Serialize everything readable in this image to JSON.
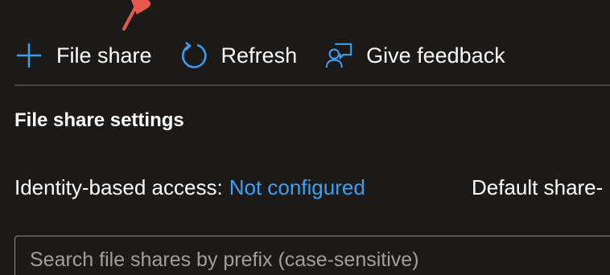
{
  "toolbar": {
    "add_file_share_label": "File share",
    "refresh_label": "Refresh",
    "feedback_label": "Give feedback"
  },
  "section": {
    "title": "File share settings"
  },
  "settings": {
    "identity_key": "Identity-based access:",
    "identity_value": "Not configured",
    "default_key": "Default share-"
  },
  "search": {
    "placeholder": "Search file shares by prefix (case-sensitive)",
    "value": ""
  },
  "colors": {
    "background": "#1b1a19",
    "accent": "#3aa0f3",
    "divider": "#484644",
    "pointer": "#e8574b"
  },
  "icons": {
    "add": "plus-icon",
    "refresh": "refresh-icon",
    "feedback": "feedback-icon",
    "pointer": "arrow-pointer-icon"
  }
}
